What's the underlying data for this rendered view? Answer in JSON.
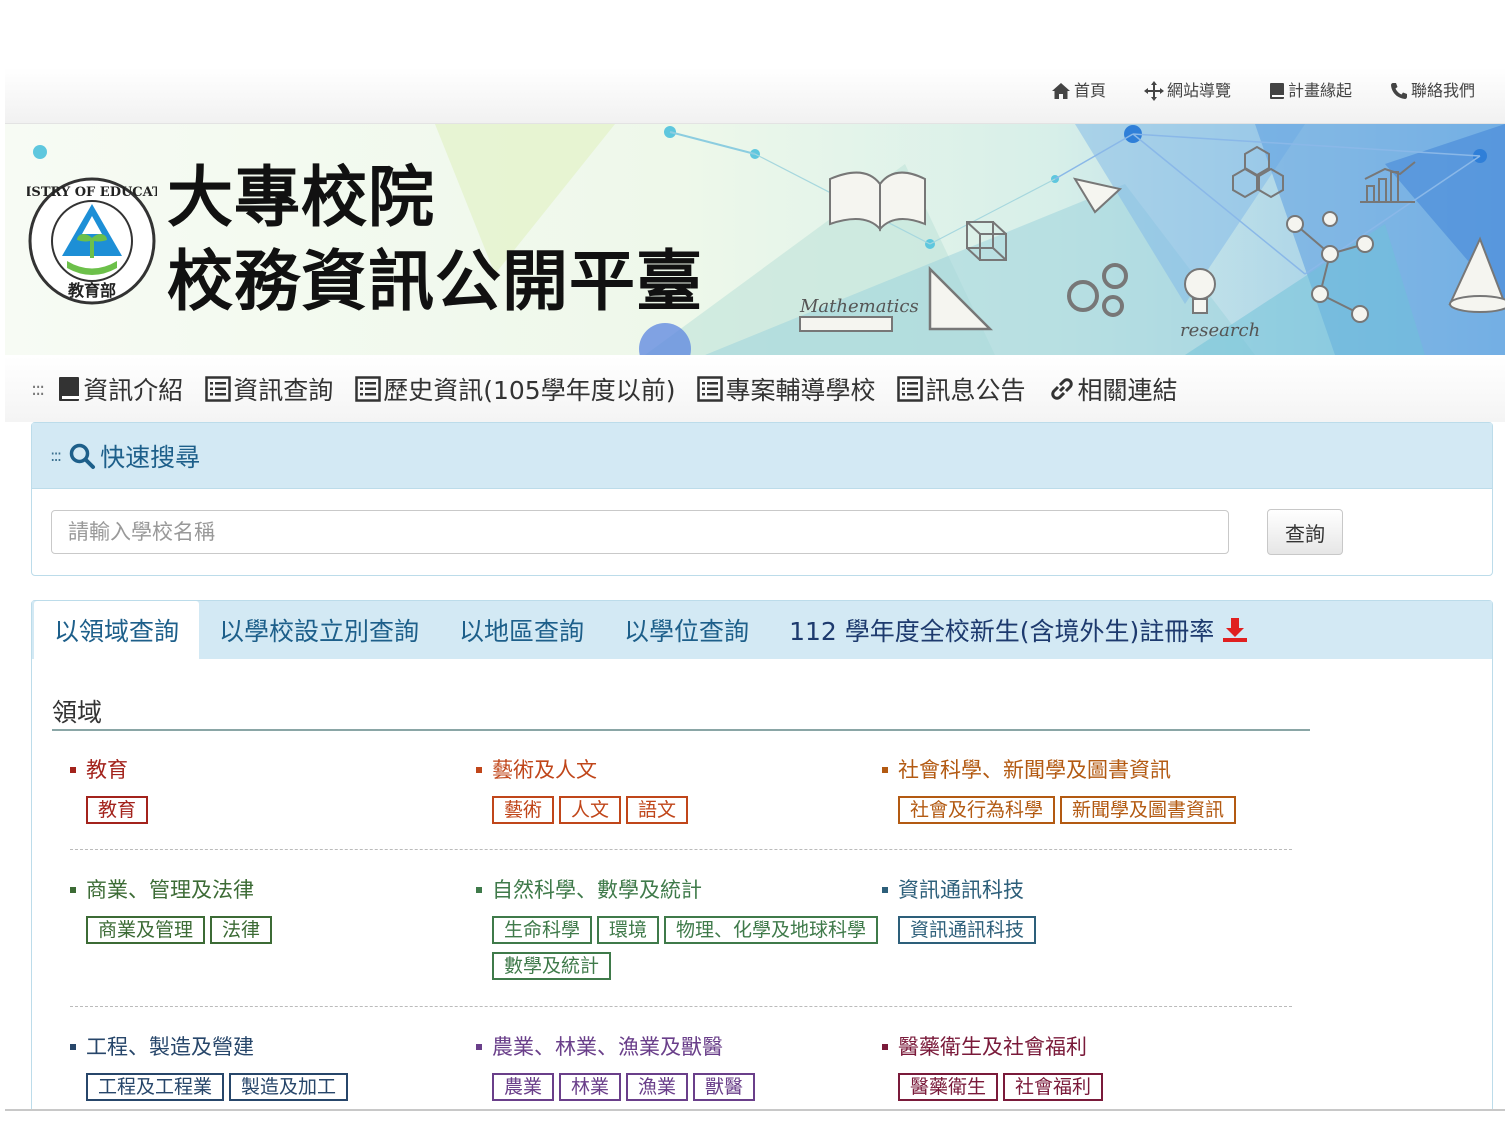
{
  "topnav": [
    {
      "label": "首頁",
      "icon": "home-icon"
    },
    {
      "label": "網站導覽",
      "icon": "move-icon"
    },
    {
      "label": "計畫緣起",
      "icon": "book-icon"
    },
    {
      "label": "聯絡我們",
      "icon": "phone-icon"
    }
  ],
  "banner": {
    "title_line1": "大專校院",
    "title_line2": "校務資訊公開平臺",
    "logo_text": "MINISTRY OF EDUCATION",
    "logo_cn": "教育部",
    "deco_mathematics": "Mathematics",
    "deco_research": "research"
  },
  "mainnav": [
    {
      "label": "資訊介紹",
      "icon": "book-icon"
    },
    {
      "label": "資訊查詢",
      "icon": "list-icon"
    },
    {
      "label": "歷史資訊(105學年度以前)",
      "icon": "list-icon"
    },
    {
      "label": "專案輔導學校",
      "icon": "list-icon"
    },
    {
      "label": "訊息公告",
      "icon": "list-icon"
    },
    {
      "label": "相關連結",
      "icon": "link-icon"
    }
  ],
  "search": {
    "title": "快速搜尋",
    "placeholder": "請輸入學校名稱",
    "button": "查詢"
  },
  "tabs": [
    {
      "label": "以領域查詢",
      "active": true
    },
    {
      "label": "以學校設立別查詢",
      "active": false
    },
    {
      "label": "以地區查詢",
      "active": false
    },
    {
      "label": "以學位查詢",
      "active": false
    },
    {
      "label": "112 學年度全校新生(含境外生)註冊率",
      "active": false
    }
  ],
  "domain_heading": "領域",
  "domains": [
    [
      {
        "title": "教育",
        "color": "#a3231c",
        "tags": [
          "教育"
        ]
      },
      {
        "title": "藝術及人文",
        "color": "#c0461a",
        "tags": [
          "藝術",
          "人文",
          "語文"
        ]
      },
      {
        "title": "社會科學、新聞學及圖書資訊",
        "color": "#b35a12",
        "tags": [
          "社會及行為科學",
          "新聞學及圖書資訊"
        ]
      }
    ],
    [
      {
        "title": "商業、管理及法律",
        "color": "#3c6b35",
        "tags": [
          "商業及管理",
          "法律"
        ]
      },
      {
        "title": "自然科學、數學及統計",
        "color": "#3f7a4a",
        "tags": [
          "生命科學",
          "環境",
          "物理、化學及地球科學",
          "數學及統計"
        ]
      },
      {
        "title": "資訊通訊科技",
        "color": "#2d5f7a",
        "tags": [
          "資訊通訊科技"
        ]
      }
    ],
    [
      {
        "title": "工程、製造及營建",
        "color": "#27466a",
        "tags": [
          "工程及工程業",
          "製造及加工"
        ]
      },
      {
        "title": "農業、林業、漁業及獸醫",
        "color": "#6a3f8a",
        "tags": [
          "農業",
          "林業",
          "漁業",
          "獸醫"
        ]
      },
      {
        "title": "醫藥衛生及社會福利",
        "color": "#7a1a3a",
        "tags": [
          "醫藥衛生",
          "社會福利"
        ]
      }
    ]
  ],
  "colors": {
    "accent_blue": "#1d5f8a",
    "panel_header": "#d3e9f4",
    "download_red": "#e02020"
  }
}
